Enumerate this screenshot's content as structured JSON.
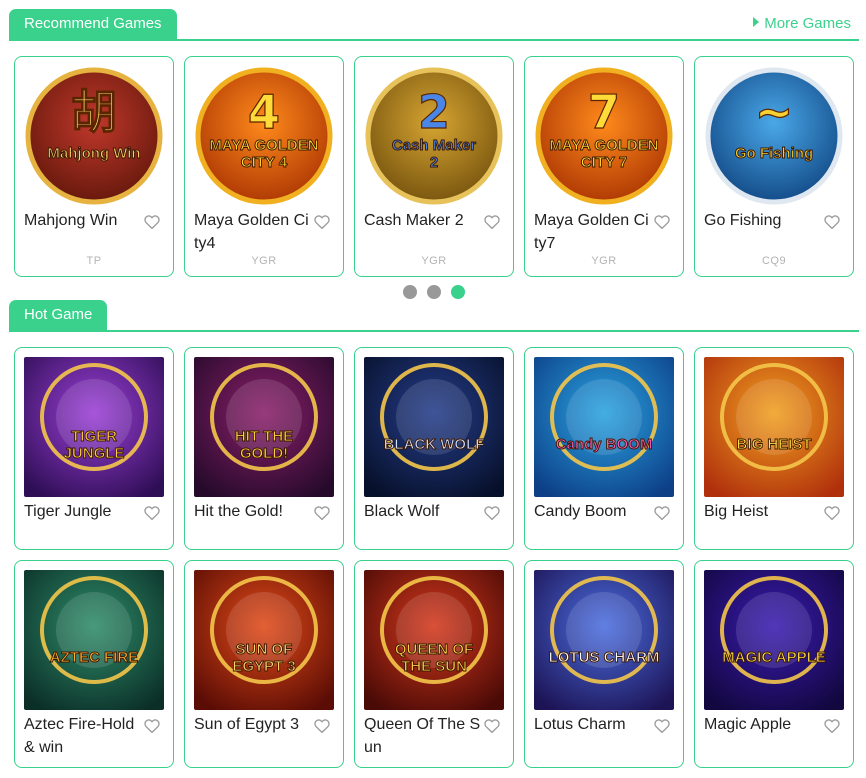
{
  "recommend": {
    "tab_label": "Recommend Games",
    "more_label": "More Games",
    "games": [
      {
        "title": "Mahjong Win",
        "provider": "TP",
        "art_text": "Mahjong Win"
      },
      {
        "title": "Maya Golden City4",
        "provider": "YGR",
        "art_text": "MAYA GOLDEN CITY 4"
      },
      {
        "title": "Cash Maker 2",
        "provider": "YGR",
        "art_text": "Cash Maker 2"
      },
      {
        "title": "Maya Golden City7",
        "provider": "YGR",
        "art_text": "MAYA GOLDEN CITY 7"
      },
      {
        "title": "Go Fishing",
        "provider": "CQ9",
        "art_text": "Go Fishing"
      }
    ],
    "pagination": {
      "count": 3,
      "active_index": 2
    }
  },
  "hot": {
    "tab_label": "Hot Game",
    "games": [
      {
        "title": "Tiger Jungle",
        "art_text": "TIGER JUNGLE"
      },
      {
        "title": "Hit the Gold!",
        "art_text": "HIT THE GOLD!"
      },
      {
        "title": "Black Wolf",
        "art_text": "BLACK WOLF"
      },
      {
        "title": "Candy Boom",
        "art_text": "Candy BOOM"
      },
      {
        "title": "Big Heist",
        "art_text": "BIG HEIST"
      },
      {
        "title": "Aztec Fire-Hold & win",
        "art_text": "AZTEC FIRE"
      },
      {
        "title": "Sun of Egypt 3",
        "art_text": "SUN OF EGYPT 3"
      },
      {
        "title": "Queen Of The Sun",
        "art_text": "QUEEN OF THE SUN"
      },
      {
        "title": "Lotus Charm",
        "art_text": "LOTUS CHARM"
      },
      {
        "title": "Magic Apple",
        "art_text": "MAGIC APPLE"
      }
    ]
  },
  "colors": {
    "accent": "#3ad18c",
    "dot_inactive": "#999999",
    "provider_text": "#b3b3b3"
  },
  "icons": {
    "favorite": "heart-outline-icon",
    "more_arrow": "caret-right-icon"
  }
}
